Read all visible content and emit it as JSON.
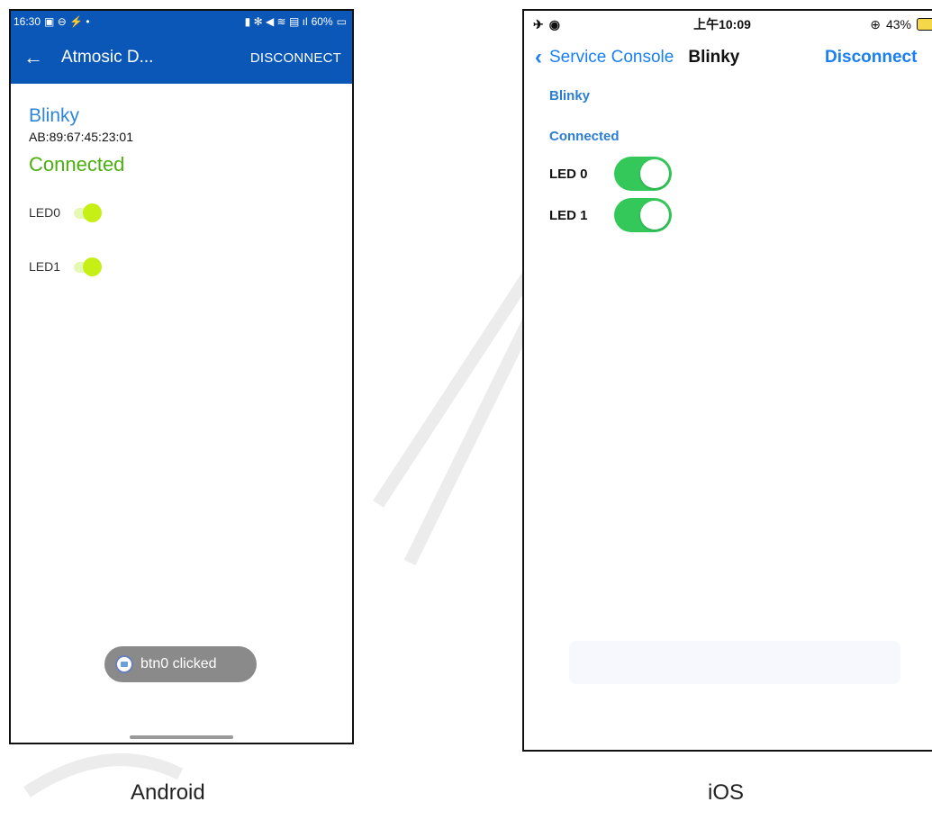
{
  "android": {
    "status_time": "16:30",
    "status_battery": "60%",
    "title": "Atmosic D...",
    "disconnect_label": "DISCONNECT",
    "device_name": "Blinky",
    "device_address": "AB:89:67:45:23:01",
    "connection_status": "Connected",
    "leds": [
      {
        "label": "LED0",
        "on": true
      },
      {
        "label": "LED1",
        "on": true
      }
    ],
    "toast": "btn0 clicked",
    "colors": {
      "toolbar": "#0a57b8",
      "name": "#2f86d4",
      "connected": "#4caf10",
      "switch_thumb": "#c6ef15"
    }
  },
  "ios": {
    "status_time": "上午10:09",
    "status_battery": "43%",
    "back_label": "Service Console",
    "title": "Blinky",
    "disconnect_label": "Disconnect",
    "device_name": "Blinky",
    "connection_status": "Connected",
    "leds": [
      {
        "label": "LED 0",
        "on": true
      },
      {
        "label": "LED 1",
        "on": true
      }
    ],
    "button_label": "",
    "colors": {
      "tint": "#1a7ff0",
      "switch_on": "#34c759"
    }
  },
  "captions": {
    "android": "Android",
    "ios": "iOS"
  }
}
